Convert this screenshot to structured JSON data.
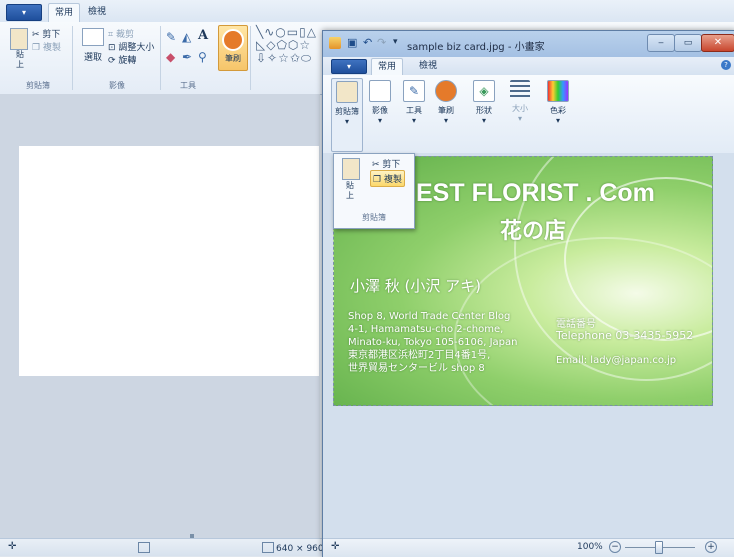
{
  "back": {
    "menu_label": "▾",
    "tabs": [
      "常用",
      "檢視"
    ],
    "clipboard": {
      "paste": "貼上",
      "cut": "剪下",
      "copy": "複製",
      "label": "剪貼簿"
    },
    "image": {
      "select": "選取",
      "crop": "裁剪",
      "resize": "調整大小",
      "rotate": "旋轉",
      "label": "影像"
    },
    "tools": {
      "label": "工具"
    },
    "brushes": {
      "label": "筆刷"
    },
    "status_size": "640 × 960像"
  },
  "front": {
    "title": "sample biz card.jpg - 小畫家",
    "menu_label": "▾",
    "tabs": [
      "常用",
      "檢視"
    ],
    "ribbon": [
      "剪貼簿",
      "影像",
      "工具",
      "筆刷",
      "形狀",
      "大小",
      "色彩"
    ],
    "popup": {
      "paste": "貼上",
      "cut": "剪下",
      "copy": "複製",
      "label": "剪貼簿"
    },
    "zoom": "100%"
  },
  "card": {
    "title": "EST FLORIST . Com",
    "subtitle": "花の店",
    "name": "小澤 秋 (小沢 アキ)",
    "address": [
      "Shop 8, World Trade Center Blog",
      "4-1, Hamamatsu-cho 2-chome,",
      "Minato-ku, Tokyo 105-6106, Japan",
      "東京都港区浜松町2丁目4番1号,",
      "世界貿易センタービル shop 8"
    ],
    "phone_label": "電話番号",
    "phone": "Telephone 03-3435-5952",
    "email": "Email: lady@japan.co.jp"
  },
  "colors": {
    "accent": "#f0a030",
    "title_bar": "#a4c0e3"
  }
}
